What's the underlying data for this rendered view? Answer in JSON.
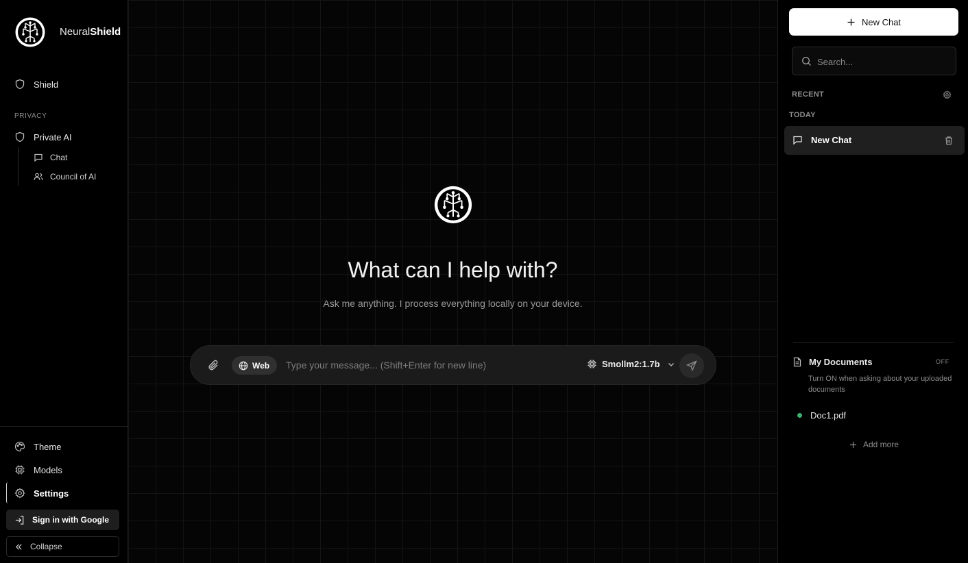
{
  "brand": {
    "name_regular": "Neural",
    "name_bold": "Shield"
  },
  "sidebar": {
    "top_item": {
      "label": "Shield",
      "icon": "shield-icon"
    },
    "section_label": "PRIVACY",
    "section_item": {
      "label": "Private AI",
      "icon": "shield-icon"
    },
    "sub_items": [
      {
        "label": "Chat",
        "icon": "chat-bubble-icon"
      },
      {
        "label": "Council of AI",
        "icon": "users-icon"
      }
    ],
    "bottom_items": [
      {
        "label": "Theme",
        "icon": "palette-icon"
      },
      {
        "label": "Models",
        "icon": "cpu-icon"
      },
      {
        "label": "Settings",
        "icon": "gear-icon"
      }
    ],
    "sign_in_label": "Sign in with Google",
    "collapse_label": "Collapse"
  },
  "main": {
    "title": "What can I help with?",
    "subtitle": "Ask me anything. I process everything locally on your device.",
    "composer": {
      "web_label": "Web",
      "placeholder": "Type your message... (Shift+Enter for new line)",
      "value": "",
      "model": "Smollm2:1.7b"
    }
  },
  "right_panel": {
    "new_chat_label": "New Chat",
    "search_placeholder": "Search...",
    "recent_label": "RECENT",
    "today_label": "TODAY",
    "chats": [
      {
        "label": "New Chat"
      }
    ],
    "documents": {
      "title": "My Documents",
      "toggle": "OFF",
      "hint": "Turn ON when asking about your uploaded documents",
      "files": [
        {
          "name": "Doc1.pdf",
          "status_color": "#3fae73"
        }
      ],
      "add_more_label": "Add more"
    }
  },
  "colors": {
    "background": "#000000",
    "panel": "#1b1b1b",
    "accent": "#ffffff",
    "status_green": "#3fae73"
  }
}
